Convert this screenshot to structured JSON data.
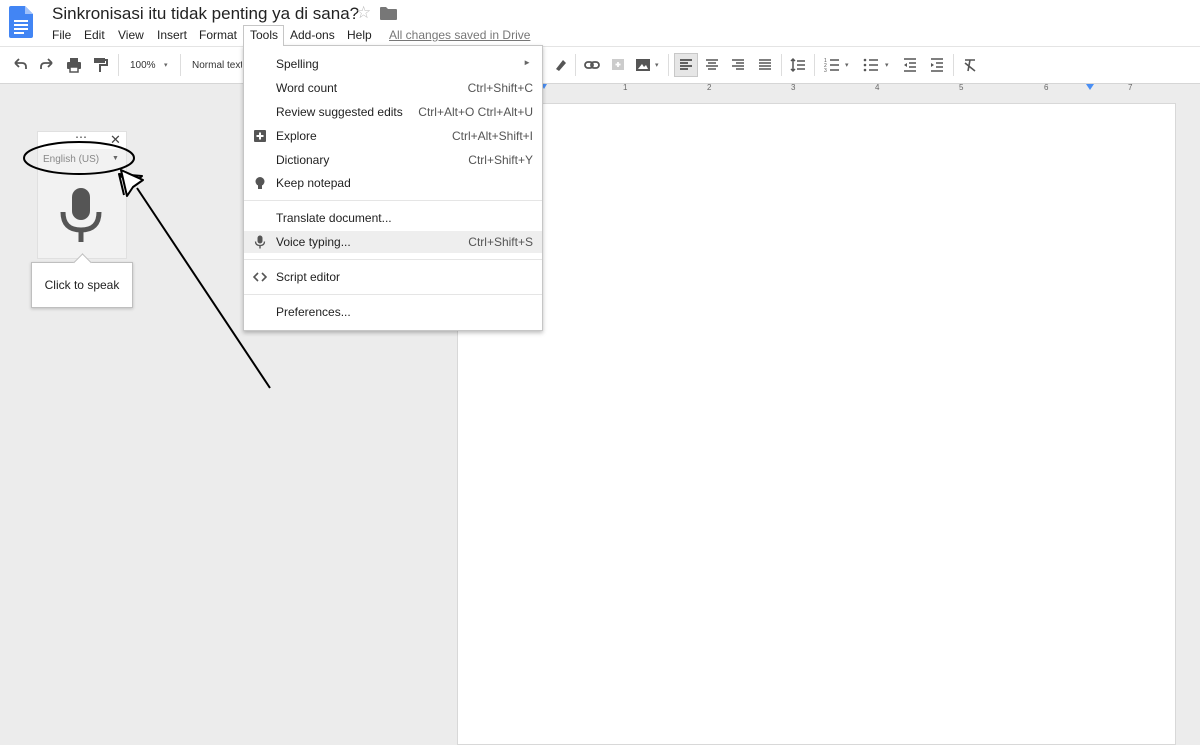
{
  "doc": {
    "title": "Sinkronisasi itu tidak penting ya di sana?",
    "star_glyph": "☆",
    "saved_status": "All changes saved in Drive"
  },
  "menubar": {
    "items": [
      {
        "label": "File"
      },
      {
        "label": "Edit"
      },
      {
        "label": "View"
      },
      {
        "label": "Insert"
      },
      {
        "label": "Format"
      },
      {
        "label": "Tools"
      },
      {
        "label": "Add-ons"
      },
      {
        "label": "Help"
      }
    ],
    "open_menu": "Tools"
  },
  "toolbar": {
    "zoom": "100%",
    "style": "Normal text"
  },
  "ruler": {
    "numbers": [
      "1",
      "2",
      "3",
      "4",
      "5",
      "6",
      "7"
    ]
  },
  "tools_menu": {
    "items": [
      {
        "label": "Spelling",
        "shortcut": "",
        "icon": "",
        "submenu": true
      },
      {
        "label": "Word count",
        "shortcut": "Ctrl+Shift+C",
        "icon": ""
      },
      {
        "label": "Review suggested edits",
        "shortcut": "Ctrl+Alt+O Ctrl+Alt+U",
        "icon": ""
      },
      {
        "label": "Explore",
        "shortcut": "Ctrl+Alt+Shift+I",
        "icon": "explore-icon"
      },
      {
        "label": "Dictionary",
        "shortcut": "Ctrl+Shift+Y",
        "icon": ""
      },
      {
        "label": "Keep notepad",
        "shortcut": "",
        "icon": "lightbulb-icon"
      },
      {
        "label": "Translate document...",
        "shortcut": "",
        "icon": ""
      },
      {
        "label": "Voice typing...",
        "shortcut": "Ctrl+Shift+S",
        "icon": "microphone-icon",
        "highlighted": true
      },
      {
        "label": "Script editor",
        "shortcut": "",
        "icon": "code-icon"
      },
      {
        "label": "Preferences...",
        "shortcut": "",
        "icon": ""
      }
    ]
  },
  "voice_widget": {
    "language": "English (US)",
    "tooltip": "Click to speak"
  },
  "colors": {
    "accent_blue": "#4285f4",
    "menu_highlight": "#eeeeee",
    "icon_gray": "#5f5f5f"
  }
}
